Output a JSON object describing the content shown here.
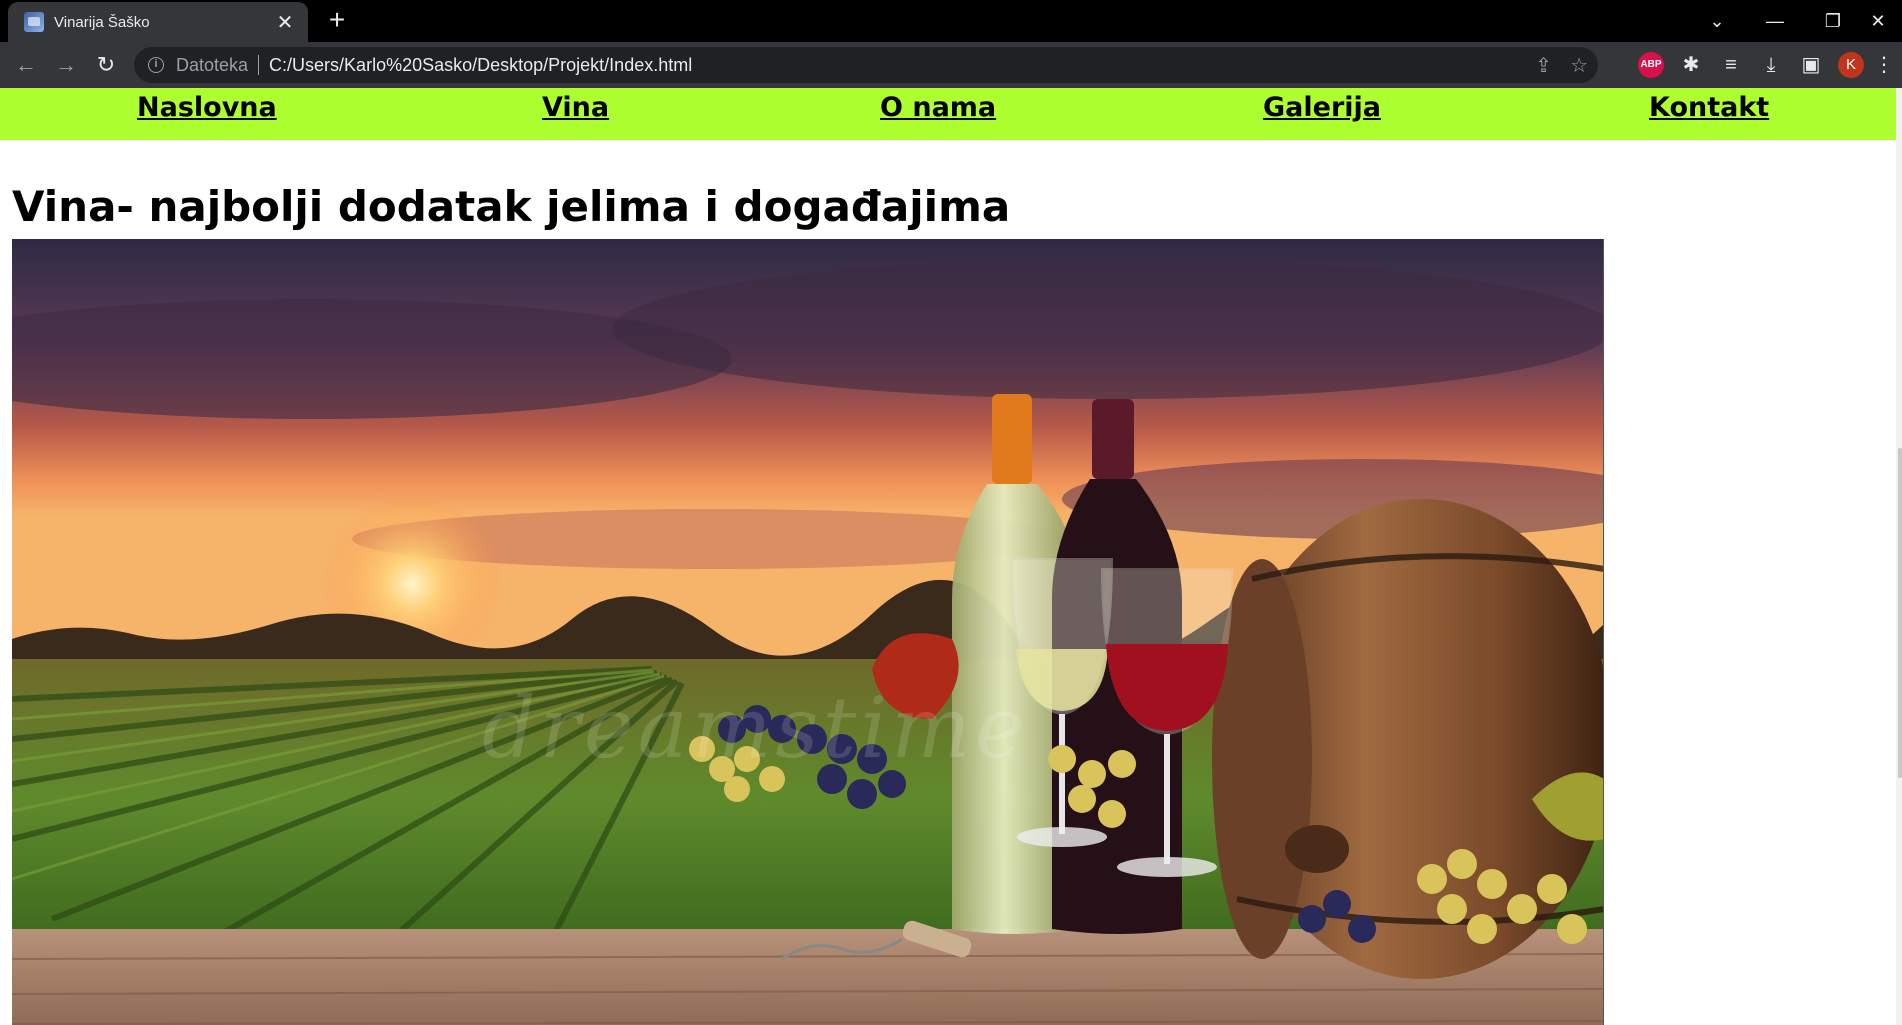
{
  "browser": {
    "tab_title": "Vinarija Šaško",
    "scheme_label": "Datoteka",
    "url": "C:/Users/Karlo%20Sasko/Desktop/Projekt/Index.html",
    "profile_initial": "K",
    "adblock_label": "ABP",
    "icons": [
      "favicon",
      "close-icon",
      "plus-icon",
      "chevron-down-icon",
      "minimize-icon",
      "restore-icon",
      "close-window-icon",
      "back-arrow-icon",
      "forward-arrow-icon",
      "reload-icon",
      "info-icon",
      "share-icon",
      "star-icon",
      "adblock-icon",
      "puzzle-icon",
      "media-queue-icon",
      "download-icon",
      "sidepanel-icon",
      "kebab-menu-icon"
    ]
  },
  "site": {
    "nav": [
      {
        "label": "Naslovna"
      },
      {
        "label": "Vina"
      },
      {
        "label": "O nama"
      },
      {
        "label": "Galerija"
      },
      {
        "label": "Kontakt"
      }
    ],
    "heading": "Vina- najbolji dodatak jelima i događajima",
    "hero_watermark": "dreamstime",
    "nav_color": "#adff2f"
  }
}
